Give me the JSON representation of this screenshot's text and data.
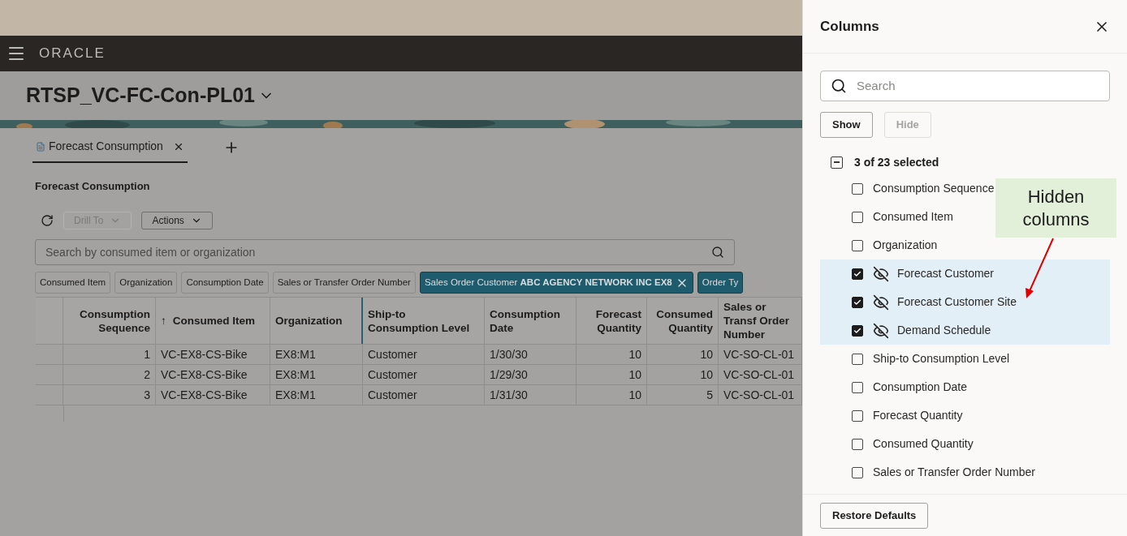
{
  "header": {
    "brand": "ORACLE"
  },
  "page_title": "RTSP_VC-FC-Con-PL01",
  "tabs": [
    {
      "label": "Forecast Consumption",
      "selected": true
    }
  ],
  "section_title": "Forecast Consumption",
  "toolbar": [
    {
      "label": "Drill To",
      "disabled": true
    },
    {
      "label": "Actions",
      "disabled": false
    }
  ],
  "search": {
    "placeholder": "Search by consumed item or organization"
  },
  "filter_chips": [
    {
      "label": "Consumed Item",
      "selected": false
    },
    {
      "label": "Organization",
      "selected": false
    },
    {
      "label": "Consumption Date",
      "selected": false
    },
    {
      "label": "Sales or Transfer Order Number",
      "selected": false
    },
    {
      "label": "Sales Order Customer **ABC AGENCY NETWORK INC EX8**",
      "selected": true,
      "removable": true
    },
    {
      "label": "Order Ty",
      "selected": true,
      "removable": false
    }
  ],
  "table": {
    "columns": [
      {
        "label": "Consumption Sequence",
        "kind": "number"
      },
      {
        "label": "Consumed Item",
        "kind": "text",
        "sort_mark": "↑"
      },
      {
        "label": "Organization",
        "kind": "text"
      },
      {
        "label": "Ship-to Consumption Level",
        "kind": "text"
      },
      {
        "label": "Consumption Date",
        "kind": "text"
      },
      {
        "label": "Forecast Quantity",
        "kind": "number"
      },
      {
        "label": "Consumed Quantity",
        "kind": "number"
      },
      {
        "label": "Sales or Transf Order Number",
        "kind": "text"
      }
    ],
    "rows": [
      [
        "1",
        "VC-EX8-CS-Bike",
        "EX8:M1",
        "Customer",
        "1/30/30",
        "10",
        "10",
        "VC-SO-CL-01"
      ],
      [
        "2",
        "VC-EX8-CS-Bike",
        "EX8:M1",
        "Customer",
        "1/29/30",
        "10",
        "10",
        "VC-SO-CL-01"
      ],
      [
        "3",
        "VC-EX8-CS-Bike",
        "EX8:M1",
        "Customer",
        "1/31/30",
        "10",
        "5",
        "VC-SO-CL-01"
      ]
    ]
  },
  "panel": {
    "title": "Columns",
    "search": {
      "placeholder": "Search"
    },
    "buttons": [
      {
        "label": "Show",
        "disabled": false
      },
      {
        "label": "Hide",
        "disabled": true
      }
    ],
    "select_all": {
      "label": "3 of 23 selected",
      "partial": true
    },
    "items": [
      {
        "label": "Consumption Sequence",
        "checked": false,
        "hidden": false
      },
      {
        "label": "Consumed Item",
        "checked": false,
        "hidden": false
      },
      {
        "label": "Organization",
        "checked": false,
        "hidden": false
      },
      {
        "label": "Forecast Customer",
        "checked": true,
        "hidden": true
      },
      {
        "label": "Forecast Customer Site",
        "checked": true,
        "hidden": true
      },
      {
        "label": "Demand Schedule",
        "checked": true,
        "hidden": true
      },
      {
        "label": "Ship-to Consumption Level",
        "checked": false,
        "hidden": false
      },
      {
        "label": "Consumption Date",
        "checked": false,
        "hidden": false
      },
      {
        "label": "Forecast Quantity",
        "checked": false,
        "hidden": false
      },
      {
        "label": "Consumed Quantity",
        "checked": false,
        "hidden": false
      },
      {
        "label": "Sales or Transfer Order Number",
        "checked": false,
        "hidden": false
      }
    ],
    "footer_button": "Restore Defaults"
  },
  "annotation": {
    "text": "Hidden columns"
  }
}
